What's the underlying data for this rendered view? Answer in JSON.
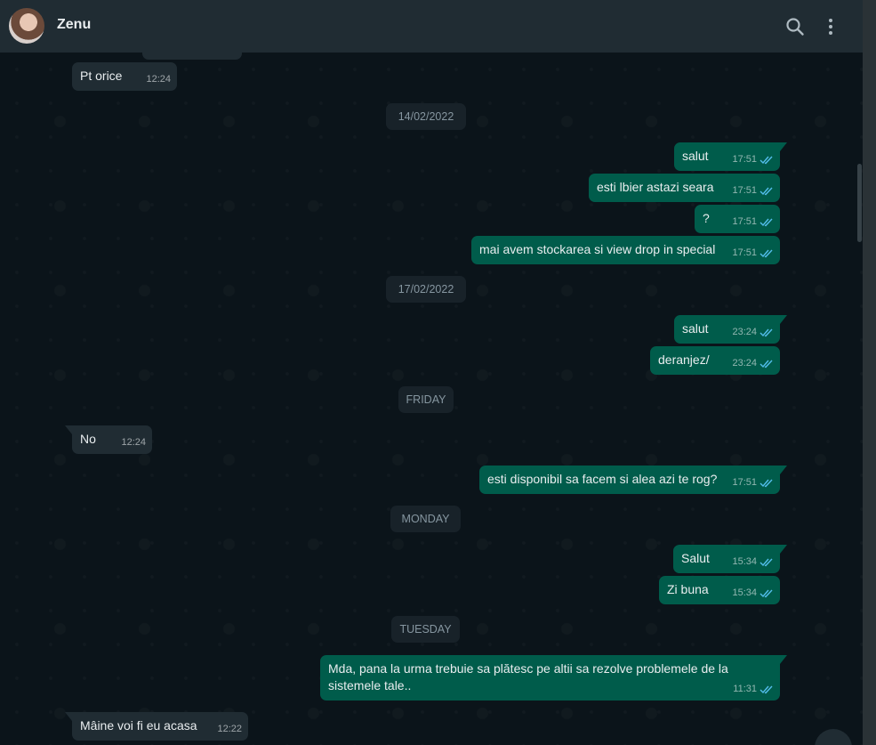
{
  "header": {
    "contact_name": "Zenu"
  },
  "colors": {
    "header_bg": "#202c33",
    "chat_bg": "#0b141a",
    "incoming_bubble": "#202c33",
    "outgoing_bubble": "#005c4b",
    "read_ticks": "#53bdeb"
  },
  "icons": [
    "search-icon",
    "menu-icon",
    "double-check-icon"
  ],
  "messages": {
    "m0": {
      "text": "Pt orice",
      "time": "12:24"
    },
    "d1": "14/02/2022",
    "m1": {
      "text": "salut",
      "time": "17:51"
    },
    "m2": {
      "text": "esti lbier astazi seara",
      "time": "17:51"
    },
    "m3": {
      "text": "?",
      "time": "17:51"
    },
    "m4": {
      "text": "mai avem stockarea si view drop in special",
      "time": "17:51"
    },
    "d2": "17/02/2022",
    "m5": {
      "text": "salut",
      "time": "23:24"
    },
    "m6": {
      "text": "deranjez/",
      "time": "23:24"
    },
    "d3": "FRIDAY",
    "m7": {
      "text": "No",
      "time": "12:24"
    },
    "m8": {
      "text": "esti disponibil sa facem si alea azi te rog?",
      "time": "17:51"
    },
    "d4": "MONDAY",
    "m9": {
      "text": "Salut",
      "time": "15:34"
    },
    "m10": {
      "text": "Zi buna",
      "time": "15:34"
    },
    "d5": "TUESDAY",
    "m11": {
      "text": "Mda, pana la urma trebuie sa plătesc pe altii sa rezolve problemele de la sistemele tale..",
      "time": "11:31"
    },
    "m12": {
      "text": "Mâine voi fi eu acasa",
      "time": "12:22"
    }
  }
}
